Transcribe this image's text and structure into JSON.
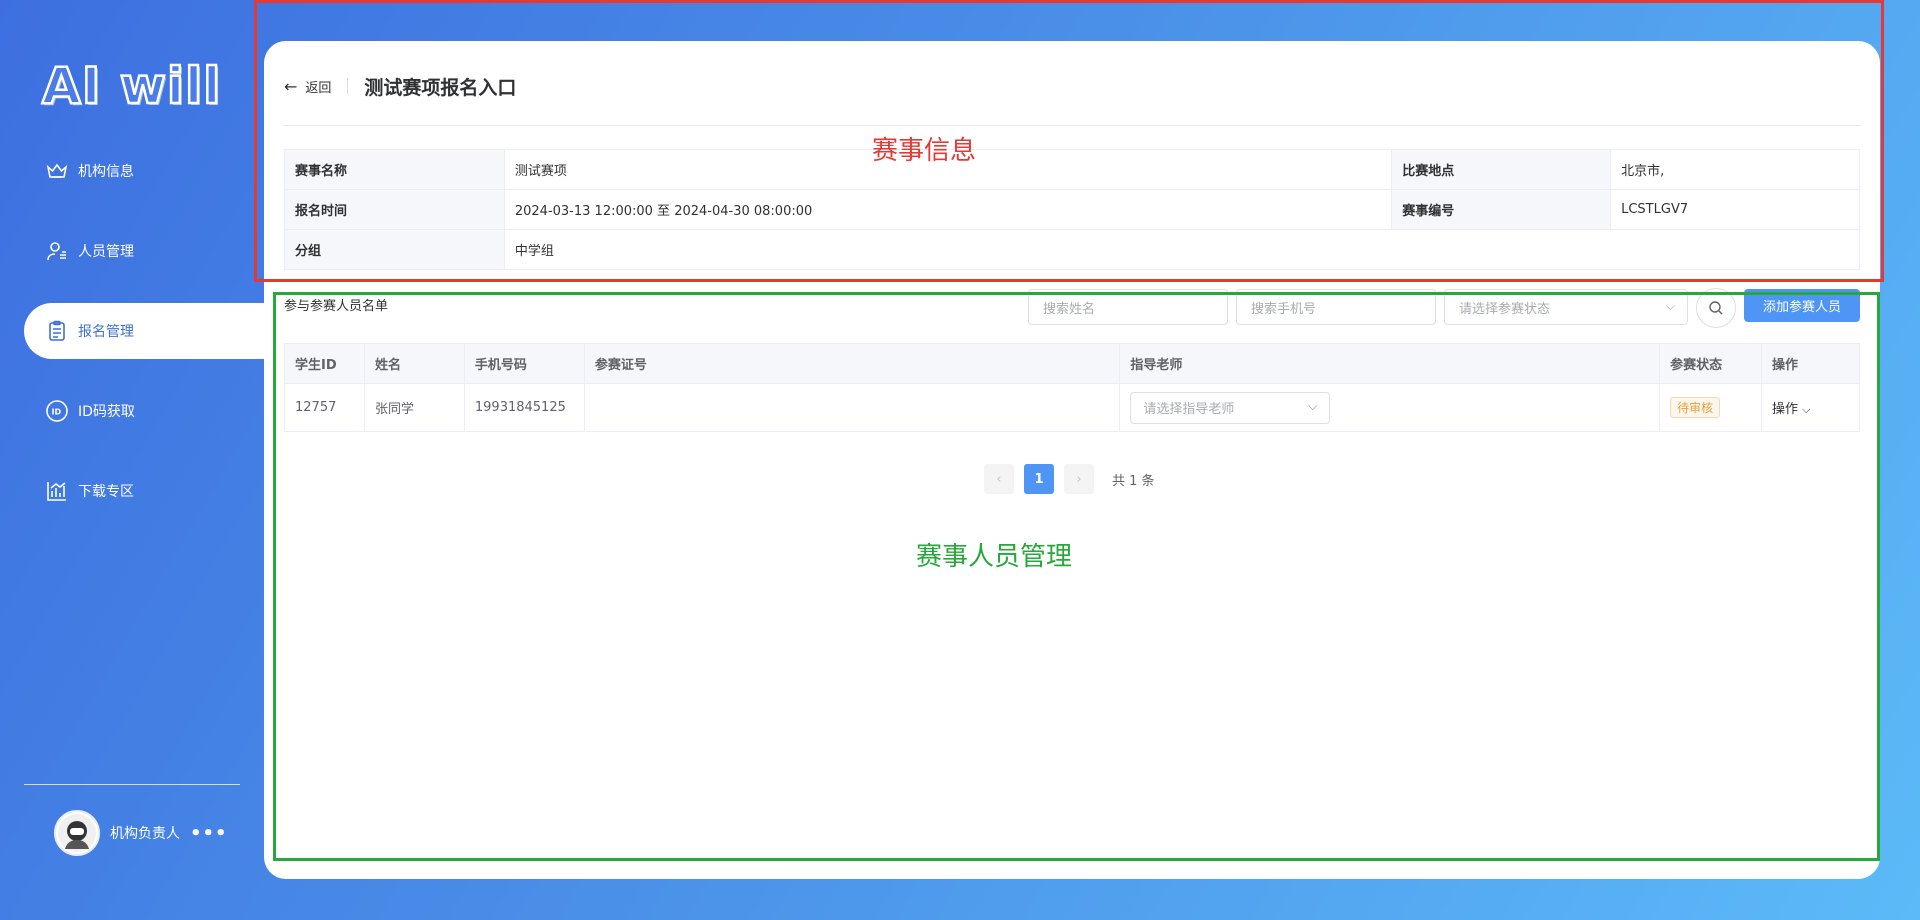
{
  "logo": "AI will",
  "sidebar": {
    "items": [
      {
        "label": "机构信息",
        "icon": "crown-icon"
      },
      {
        "label": "人员管理",
        "icon": "user-list-icon"
      },
      {
        "label": "报名管理",
        "icon": "clipboard-icon"
      },
      {
        "label": "ID码获取",
        "icon": "id-badge-icon"
      },
      {
        "label": "下载专区",
        "icon": "bar-chart-icon"
      }
    ],
    "active_item": "报名管理",
    "user": {
      "name": "机构负责人",
      "more": "•••"
    }
  },
  "header": {
    "back_label": "返回",
    "title": "测试赛项报名入口"
  },
  "event_info": {
    "name_label": "赛事名称",
    "name_value": "测试赛项",
    "location_label": "比赛地点",
    "location_value": "北京市,",
    "time_label": "报名时间",
    "time_value": "2024-03-13 12:00:00 至 2024-04-30 08:00:00",
    "code_label": "赛事编号",
    "code_value": "LCSTLGV7",
    "group_label": "分组",
    "group_value": "中学组"
  },
  "participants": {
    "title": "参与参赛人员名单",
    "search_name_placeholder": "搜索姓名",
    "search_phone_placeholder": "搜索手机号",
    "status_select_placeholder": "请选择参赛状态",
    "add_button": "添加参赛人员",
    "columns": [
      "学生ID",
      "姓名",
      "手机号码",
      "参赛证号",
      "指导老师",
      "参赛状态",
      "操作"
    ],
    "rows": [
      {
        "student_id": "12757",
        "name": "张同学",
        "phone": "19931845125",
        "cert_no": "",
        "teacher_placeholder": "请选择指导老师",
        "status": "待审核",
        "action": "操作"
      }
    ]
  },
  "pagination": {
    "current_page": "1",
    "total_text": "共 1 条"
  },
  "annotations": {
    "red_label": "赛事信息",
    "green_label": "赛事人员管理"
  },
  "colors": {
    "primary": "#4f95f5",
    "red_annotation": "#e53935",
    "green_annotation": "#27a83a",
    "pending": "#e6a23c"
  }
}
